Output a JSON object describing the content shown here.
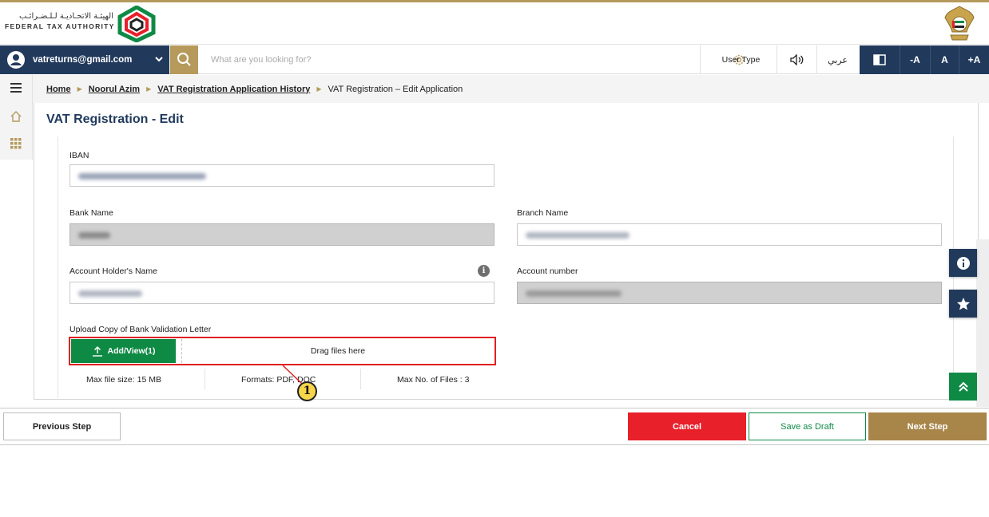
{
  "header": {
    "logo_arabic": "الهيئـة الاتحـاديـة لـلـضـرائـب",
    "logo_english": "FEDERAL TAX AUTHORITY",
    "emblem": "uae-emblem-icon"
  },
  "navbar": {
    "user_email": "vatreturns@gmail.com",
    "search_placeholder": "What are you looking for?",
    "user_type_label": "User Type",
    "arabic_label": "عربي",
    "font_decrease": "-A",
    "font_normal": "A",
    "font_increase": "+A"
  },
  "breadcrumb": {
    "items": [
      "Home",
      "Noorul Azim",
      "VAT Registration Application History"
    ],
    "current": "VAT Registration – Edit Application"
  },
  "page": {
    "title": "VAT Registration - Edit"
  },
  "form": {
    "iban_label": "IBAN",
    "bank_name_label": "Bank Name",
    "branch_name_label": "Branch Name",
    "account_holder_label": "Account Holder's Name",
    "account_number_label": "Account number",
    "upload_label": "Upload Copy of Bank Validation Letter",
    "add_view_label": "Add/View(1)",
    "drag_label": "Drag files here",
    "max_size": "Max file size: 15 MB",
    "formats": "Formats: PDF, DOC",
    "max_files": "Max No. of Files : 3"
  },
  "annotation": {
    "callout_number": "1"
  },
  "footer": {
    "previous": "Previous Step",
    "cancel": "Cancel",
    "save_draft": "Save as Draft",
    "next": "Next Step"
  },
  "colors": {
    "navy": "#213a5c",
    "gold": "#b59a5b",
    "green": "#0f8a45",
    "red": "#e8202a",
    "highlight_border": "#e02020"
  }
}
